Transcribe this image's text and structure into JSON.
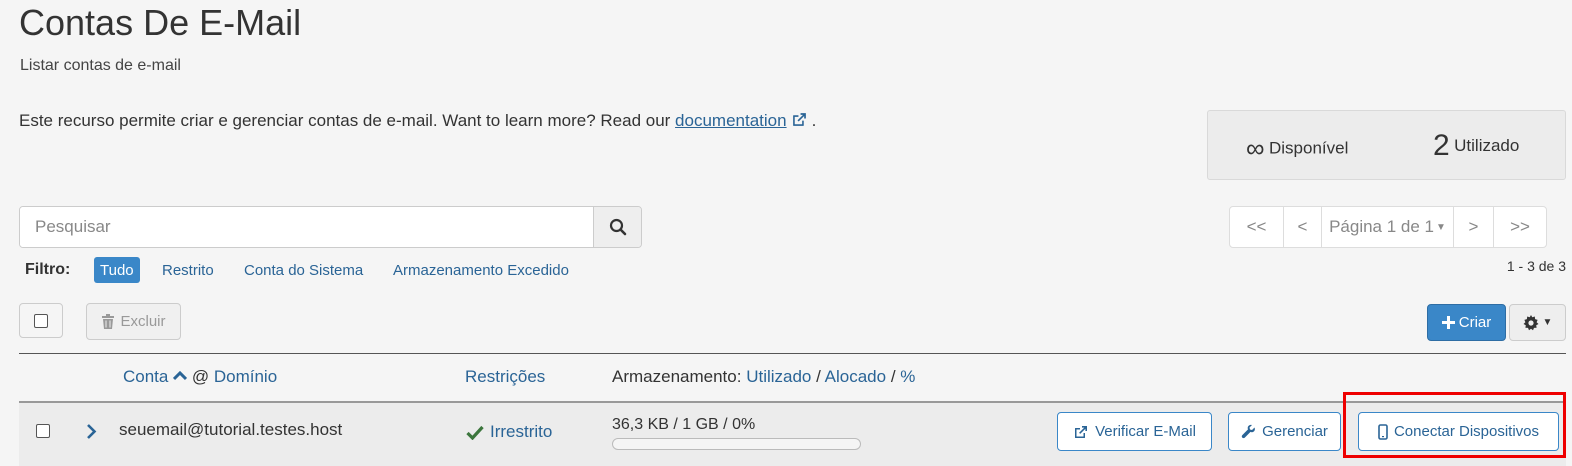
{
  "page": {
    "title": "Contas De E-Mail",
    "subtitle": "Listar contas de e-mail",
    "description_prefix": "Este recurso permite criar e gerenciar contas de e-mail. Want to learn more? Read our ",
    "documentation_link": "documentation",
    "description_suffix": "."
  },
  "stats": {
    "available_value": "∞",
    "available_label": "Disponível",
    "used_value": "2",
    "used_label": "Utilizado"
  },
  "search": {
    "placeholder": "Pesquisar",
    "icon": "search-icon"
  },
  "pagination": {
    "first": "<<",
    "prev": "<",
    "page_label": "Página 1 de 1",
    "next": ">",
    "last": ">>",
    "count": "1 - 3 de 3"
  },
  "filter": {
    "label": "Filtro:",
    "options": [
      "Tudo",
      "Restrito",
      "Conta do Sistema",
      "Armazenamento Excedido"
    ],
    "active": "Tudo"
  },
  "toolbar": {
    "delete_label": "Excluir",
    "create_label": "Criar"
  },
  "table": {
    "headers": {
      "account": "Conta",
      "at": "@",
      "domain": "Domínio",
      "restrictions": "Restrições",
      "storage_prefix": "Armazenamento:",
      "used": "Utilizado",
      "sep1": "/",
      "allocated": "Alocado",
      "sep2": "/",
      "percent": "%"
    },
    "rows": [
      {
        "email": "seuemail@tutorial.testes.host",
        "restriction": "Irrestrito",
        "storage": "36,3 KB / 1 GB / 0%",
        "usage_fraction": 0.0,
        "check_email_label": "Verificar E-Mail",
        "manage_label": "Gerenciar",
        "connect_label": "Conectar Dispositivos"
      }
    ]
  },
  "colors": {
    "primary": "#3a87c8",
    "link": "#2a6496",
    "highlight": "#ee0000",
    "success": "#3c763d"
  }
}
